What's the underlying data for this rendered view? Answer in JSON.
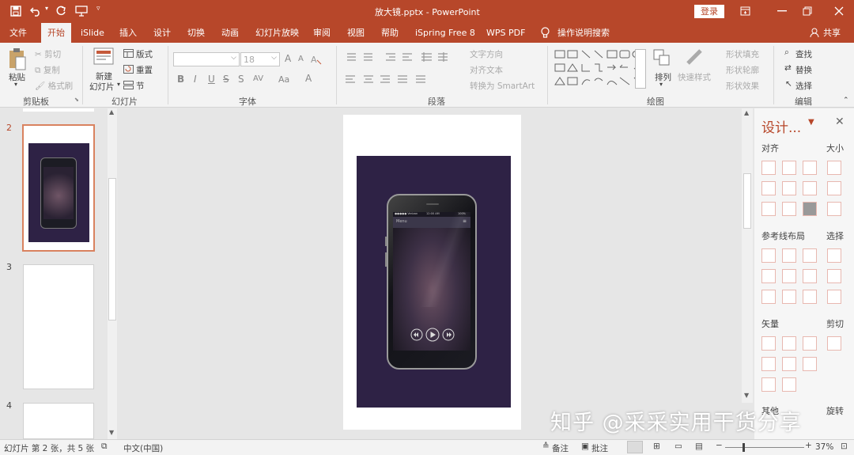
{
  "titlebar": {
    "title": "放大镜.pptx  -  PowerPoint",
    "login": "登录"
  },
  "tabs": [
    "文件",
    "开始",
    "iSlide",
    "插入",
    "设计",
    "切换",
    "动画",
    "幻灯片放映",
    "审阅",
    "视图",
    "帮助",
    "iSpring Free 8",
    "WPS PDF"
  ],
  "tell_me": "操作说明搜索",
  "share": "共享",
  "ribbon": {
    "clipboard": {
      "paste": "粘贴",
      "cut": "剪切",
      "copy": "复制",
      "format_painter": "格式刷",
      "label": "剪贴板"
    },
    "slides": {
      "new_slide_1": "新建",
      "new_slide_2": "幻灯片",
      "layout": "版式",
      "reset": "重置",
      "section": "节",
      "label": "幻灯片"
    },
    "font": {
      "size": "18",
      "label": "字体",
      "bold": "B",
      "italic": "I",
      "underline": "U",
      "strike": "S",
      "spacing": "AV",
      "case": "Aa",
      "fontcolor": "A",
      "grow": "A",
      "shrink": "A"
    },
    "paragraph": {
      "text_direction": "文字方向",
      "align_text": "对齐文本",
      "smartart": "转换为 SmartArt",
      "label": "段落"
    },
    "drawing": {
      "arrange": "排列",
      "quick_styles": "快速样式",
      "shape_fill": "形状填充",
      "shape_outline": "形状轮廓",
      "shape_effects": "形状效果",
      "label": "绘图"
    },
    "editing": {
      "find": "查找",
      "replace": "替换",
      "select": "选择",
      "label": "编辑"
    }
  },
  "thumbnails": [
    {
      "number": "2"
    },
    {
      "number": "3"
    },
    {
      "number": "4"
    }
  ],
  "phone": {
    "carrier": "●●●●● Verizon",
    "time": "12:00 AM",
    "battery": "100%",
    "menu": "Menu"
  },
  "sidepane": {
    "title": "设计...",
    "align": "对齐",
    "size": "大小",
    "guides": "参考线布局",
    "select": "选择",
    "vector": "矢量",
    "crop": "剪切",
    "other": "其他",
    "rotate": "旋转"
  },
  "status": {
    "slide_info": "幻灯片 第 2 张，共 5 张",
    "language": "中文(中国)",
    "notes": "备注",
    "comments": "批注",
    "zoom": "37%"
  },
  "watermark": "知乎 @采采实用干货分享",
  "colors": {
    "accent": "#b7472a",
    "slide_bg": "#2e2245"
  }
}
